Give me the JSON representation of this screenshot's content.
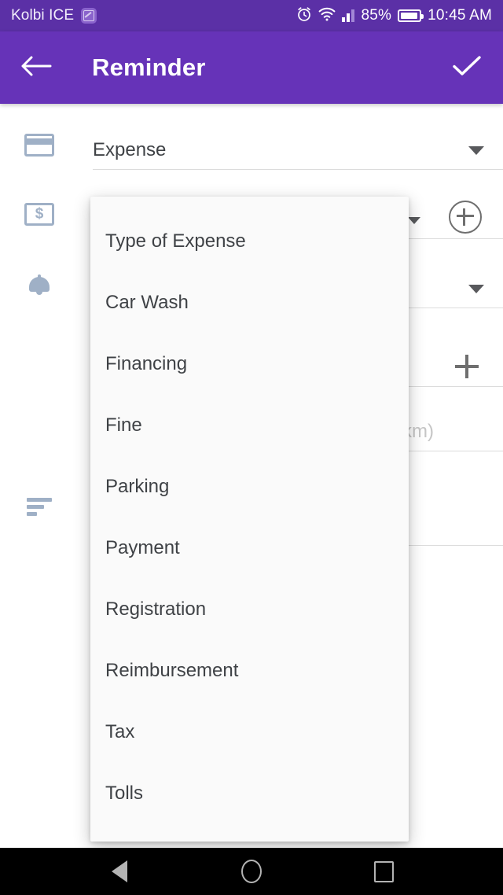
{
  "status_bar": {
    "carrier": "Kolbi ICE",
    "badge_icon": "screenshot-icon",
    "alarm_icon": "alarm-icon",
    "wifi_icon": "wifi-icon",
    "signal_icon": "signal-bars-icon",
    "battery_percent": "85%",
    "battery_icon": "battery-icon",
    "time": "10:45 AM",
    "background_color": "#5b30a6"
  },
  "app_bar": {
    "back_icon": "arrow-back-icon",
    "title": "Reminder",
    "done_icon": "check-icon",
    "background_color": "#6633b8"
  },
  "form": {
    "rows": [
      {
        "icon": "credit-card-icon",
        "value": "Expense",
        "is_hint": false,
        "trailing": "chevron-down-icon"
      },
      {
        "icon": "money-icon",
        "value": "",
        "is_hint": true,
        "trailing": "chevron-down-small-icon",
        "extra": "add-circle-icon"
      },
      {
        "icon": "bell-icon",
        "value": "",
        "is_hint": true,
        "trailing": "chevron-down-icon"
      },
      {
        "icon": "",
        "value": "",
        "is_hint": true,
        "trailing": "plus-icon"
      },
      {
        "icon": "",
        "value": "km)",
        "is_hint": true,
        "trailing": ""
      },
      {
        "icon": "notes-icon",
        "value": "",
        "is_hint": true,
        "trailing": ""
      }
    ]
  },
  "dropdown": {
    "items": [
      {
        "label": "Type of Expense"
      },
      {
        "label": "Car Wash"
      },
      {
        "label": "Financing"
      },
      {
        "label": "Fine"
      },
      {
        "label": "Parking"
      },
      {
        "label": "Payment"
      },
      {
        "label": "Registration"
      },
      {
        "label": "Reimbursement"
      },
      {
        "label": "Tax"
      },
      {
        "label": "Tolls"
      }
    ],
    "background_color": "#fafafa"
  },
  "nav_bar": {
    "back_icon": "nav-back-icon",
    "home_icon": "nav-home-icon",
    "recents_icon": "nav-recents-icon",
    "background_color": "#000000"
  }
}
